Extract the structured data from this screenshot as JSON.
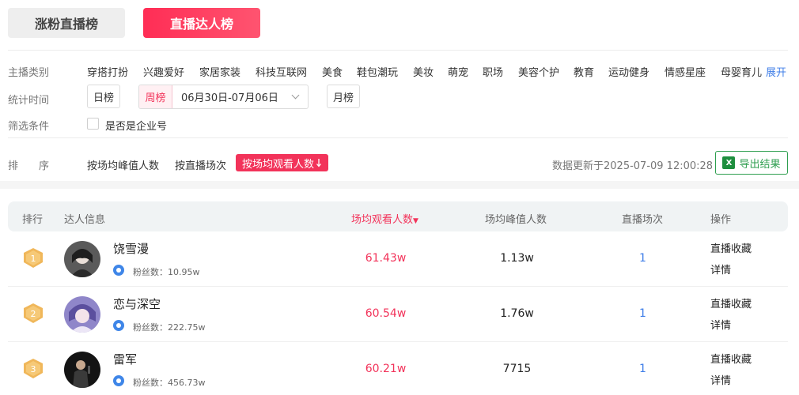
{
  "top_tabs": {
    "fans_rank": "涨粉直播榜",
    "live_rank": "直播达人榜"
  },
  "filters": {
    "category_label": "主播类别",
    "categories": [
      "穿搭打扮",
      "兴趣爱好",
      "家居家装",
      "科技互联网",
      "美食",
      "鞋包潮玩",
      "美妆",
      "萌宠",
      "职场",
      "美容个护",
      "教育",
      "运动健身",
      "情感星座",
      "母婴育儿"
    ],
    "expand": "展开",
    "time_label": "统计时间",
    "daily": "日榜",
    "weekly": "周榜",
    "week_range": "06月30日-07月06日",
    "monthly": "月榜",
    "condition_label": "筛选条件",
    "enterprise_checkbox": "是否是企业号"
  },
  "sort": {
    "label": "排　　序",
    "by_peak": "按场均峰值人数",
    "by_sessions": "按直播场次",
    "by_avg_viewers": "按场均观看人数",
    "update_text": "数据更新于2025-07-09 12:00:28",
    "export": "导出结果"
  },
  "table": {
    "headers": {
      "rank": "排行",
      "info": "达人信息",
      "avg_viewers": "场均观看人数",
      "peak": "场均峰值人数",
      "sessions": "直播场次",
      "actions": "操作"
    },
    "fans_prefix": "粉丝数：",
    "rows": [
      {
        "rank": "1",
        "name": "饶雪漫",
        "fans": "10.95w",
        "avg_viewers": "61.43w",
        "peak": "1.13w",
        "sessions": "1",
        "fav": "直播收藏",
        "detail": "详情"
      },
      {
        "rank": "2",
        "name": "恋与深空",
        "fans": "222.75w",
        "avg_viewers": "60.54w",
        "peak": "1.76w",
        "sessions": "1",
        "fav": "直播收藏",
        "detail": "详情"
      },
      {
        "rank": "3",
        "name": "雷军",
        "fans": "456.73w",
        "avg_viewers": "60.21w",
        "peak": "7715",
        "sessions": "1",
        "fav": "直播收藏",
        "detail": "详情"
      }
    ]
  },
  "colors": {
    "accent": "#f2335a",
    "link": "#3f7ee8",
    "export_green": "#2e9e4f",
    "medal": "#f0b75a"
  }
}
